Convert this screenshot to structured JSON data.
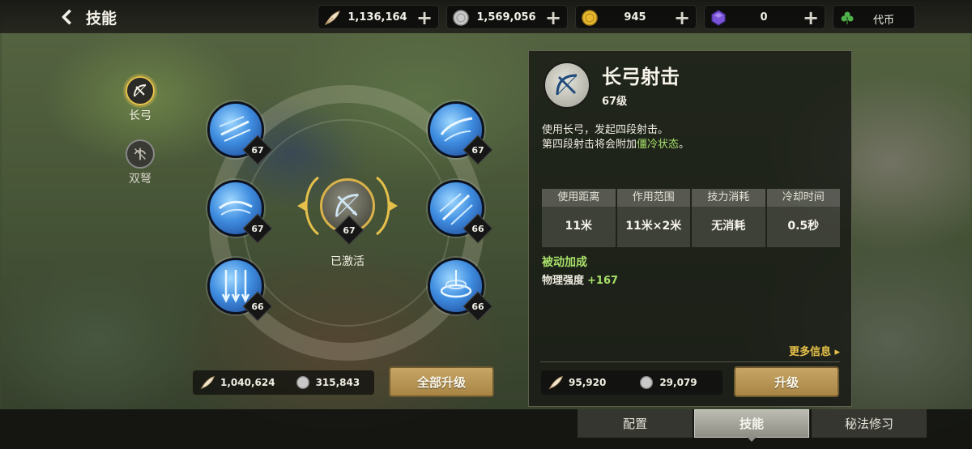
{
  "header": {
    "title": "技能",
    "back_icon": "chevron-left-icon"
  },
  "currencies": [
    {
      "name": "feather",
      "icon": "feather-icon",
      "value": "1,136,164",
      "plus": "+"
    },
    {
      "name": "silver",
      "icon": "silver-coin-icon",
      "value": "1,569,056",
      "plus": "+"
    },
    {
      "name": "gold",
      "icon": "gold-coin-icon",
      "value": "945",
      "plus": "+"
    },
    {
      "name": "gem",
      "icon": "purple-gem-icon",
      "value": "0",
      "plus": "+"
    },
    {
      "name": "token",
      "icon": "clover-icon",
      "value": "代币"
    }
  ],
  "weapons": [
    {
      "label": "长弓",
      "selected": true,
      "icon": "longbow-icon"
    },
    {
      "label": "双弩",
      "selected": false,
      "icon": "crossbow-icon"
    }
  ],
  "skills": [
    {
      "name": "skill-arrow-burst",
      "level": "67"
    },
    {
      "name": "skill-wind-arrow",
      "level": "67"
    },
    {
      "name": "skill-arrow-rain",
      "level": "66"
    },
    {
      "name": "skill-swirl-shot",
      "level": "67"
    },
    {
      "name": "skill-multi-shot",
      "level": "66"
    },
    {
      "name": "skill-tornado",
      "level": "66"
    }
  ],
  "active_skill": {
    "level": "67",
    "status": "已激活"
  },
  "left_cost": {
    "feather": "1,040,624",
    "silver": "315,843",
    "button": "全部升级"
  },
  "detail": {
    "name": "长弓射击",
    "level": "67级",
    "desc_line1": "使用长弓，发起四段射击。",
    "desc_line2_pre": "第四段射击将会附加",
    "desc_line2_hl": "僵冷状态",
    "desc_line2_post": "。",
    "stats": [
      {
        "header": "使用距离",
        "value": "11米"
      },
      {
        "header": "作用范围",
        "value": "11米×2米"
      },
      {
        "header": "技力消耗",
        "value": "无消耗"
      },
      {
        "header": "冷却时间",
        "value": "0.5秒"
      }
    ],
    "passive_title": "被动加成",
    "passive_stat": "物理强度",
    "passive_value": "+167",
    "more_info": "更多信息 ▸",
    "cost_feather": "95,920",
    "cost_silver": "29,079",
    "upgrade_button": "升级"
  },
  "tabs": [
    {
      "label": "配置",
      "active": false
    },
    {
      "label": "技能",
      "active": true
    },
    {
      "label": "秘法修习",
      "active": false
    }
  ],
  "colors": {
    "accent_gold": "#c7a665",
    "highlight_green": "#a8e06a",
    "link_yellow": "#e8c34a",
    "skill_blue": "#3f8de0"
  }
}
